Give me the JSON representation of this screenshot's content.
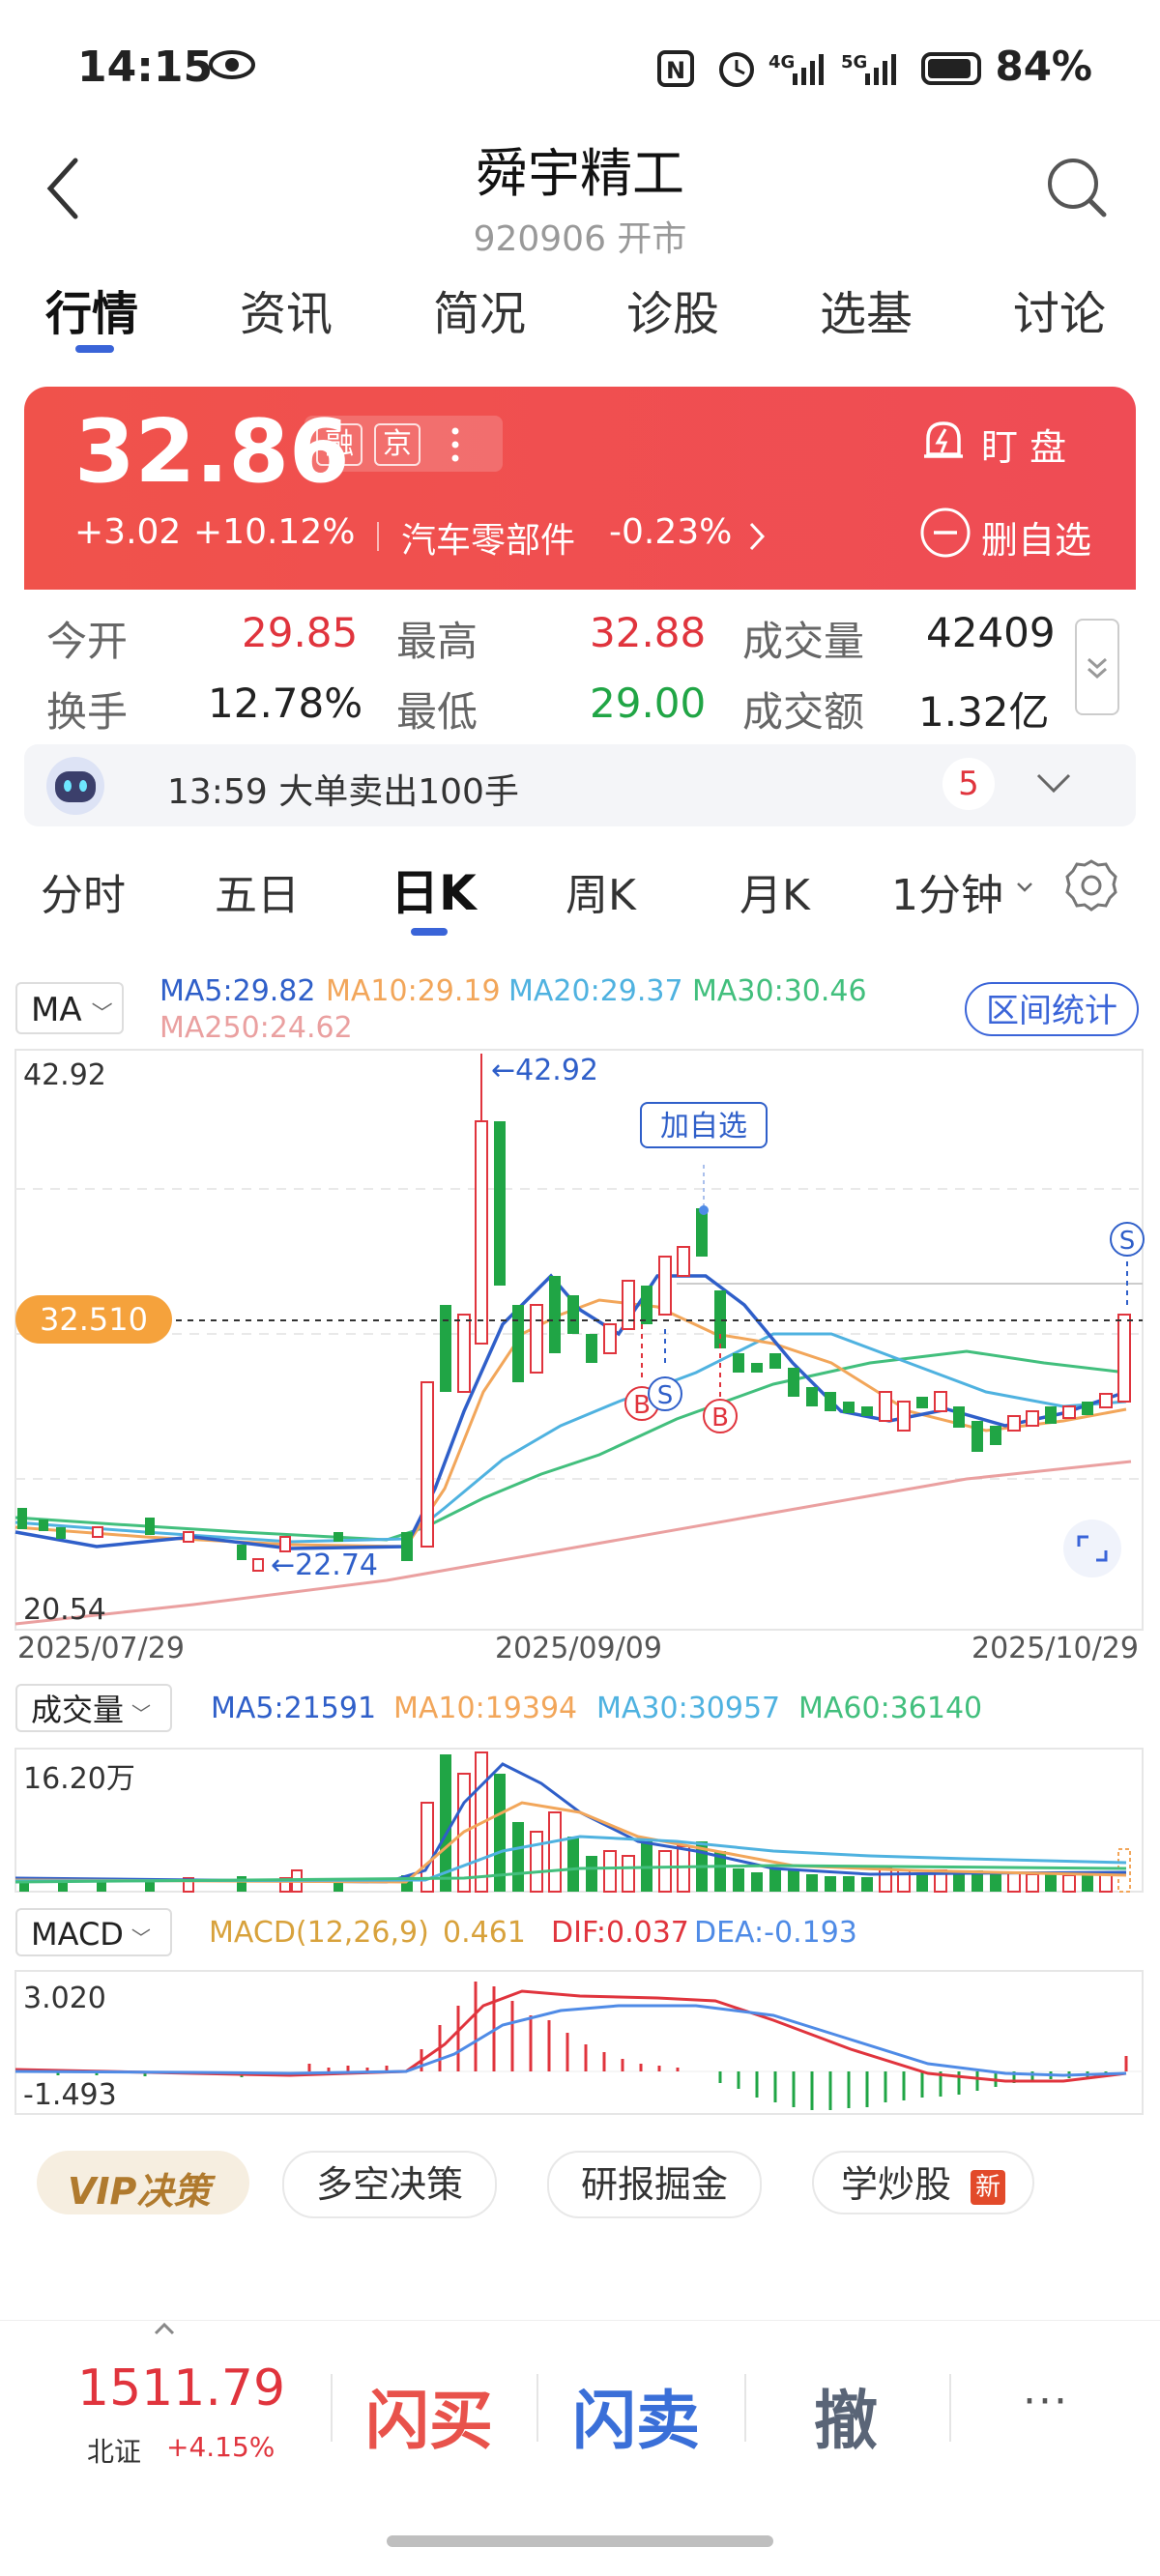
{
  "status": {
    "time": "14:15",
    "battery": "84%"
  },
  "header": {
    "title": "舜宇精工",
    "subtitle": "920906 开市"
  },
  "tabs": [
    "行情",
    "资讯",
    "简况",
    "诊股",
    "选基",
    "讨论"
  ],
  "quote": {
    "price": "32.86",
    "tag1": "融",
    "tag2": "京",
    "change": "+3.02",
    "change_pct": "+10.12%",
    "sector": "汽车零部件",
    "sector_pct": "-0.23%",
    "watch_label": "盯 盘",
    "fav_label": "删自选"
  },
  "stats": {
    "open_label": "今开",
    "open": "29.85",
    "high_label": "最高",
    "high": "32.88",
    "vol_label": "成交量",
    "vol": "42409",
    "turnover_label": "换手",
    "turnover": "12.78%",
    "low_label": "最低",
    "low": "29.00",
    "amount_label": "成交额",
    "amount": "1.32亿"
  },
  "info_bar": {
    "text": "13:59 大单卖出100手",
    "count": "5"
  },
  "chart_tabs": [
    "分时",
    "五日",
    "日K",
    "周K",
    "月K",
    "1分钟"
  ],
  "kline": {
    "indicator": "MA",
    "range_stat": "区间统计",
    "ma5": "MA5:29.82",
    "ma10": "MA10:29.19",
    "ma20": "MA20:29.37",
    "ma30": "MA30:30.46",
    "ma250": "MA250:24.62",
    "y_top": "42.92",
    "y_bottom": "20.54",
    "cur_price": "32.510",
    "high_note": "←42.92",
    "low_note": "←22.74",
    "add_fav": "加自选",
    "dates": [
      "2025/07/29",
      "2025/09/09",
      "2025/10/29"
    ],
    "marker_s": "S",
    "marker_b": "B"
  },
  "volume": {
    "label": "成交量",
    "ma5": "MA5:21591",
    "ma10": "MA10:19394",
    "ma30": "MA30:30957",
    "ma60": "MA60:36140",
    "y_top": "16.20万"
  },
  "macd": {
    "label": "MACD",
    "params": "MACD(12,26,9)",
    "macd": "0.461",
    "dif": "DIF:0.037",
    "dea": "DEA:-0.193",
    "y_top": "3.020",
    "y_bottom": "-1.493"
  },
  "feature_pills": [
    "VIP决策",
    "多空决策",
    "研报掘金",
    "学炒股",
    "新"
  ],
  "bottom_bar": {
    "index_value": "1511.79",
    "index_name": "北证",
    "index_pct": "+4.15%",
    "buy": "闪买",
    "sell": "闪卖",
    "cancel": "撤",
    "more": "···"
  },
  "colors": {
    "up": "#e0343d",
    "down": "#20a545",
    "accent": "#3a64d8",
    "ma5": "#2f5fc9",
    "ma10": "#f2a65a",
    "ma20": "#4fb2e0",
    "ma30": "#42bf7d",
    "ma250": "#eaa0a0"
  }
}
